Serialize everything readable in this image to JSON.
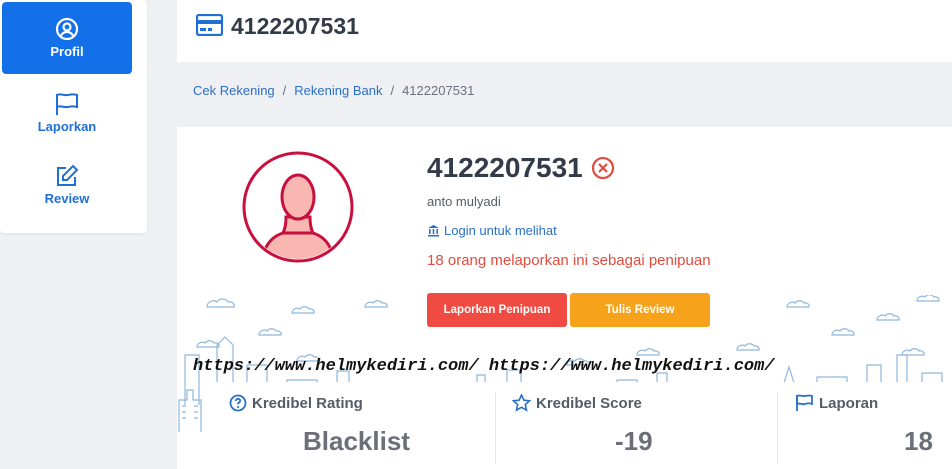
{
  "sidebar": {
    "items": [
      {
        "label": "Profil",
        "icon": "user-circle-icon",
        "active": true
      },
      {
        "label": "Laporkan",
        "icon": "flag-icon",
        "active": false
      },
      {
        "label": "Review",
        "icon": "edit-icon",
        "active": false
      }
    ]
  },
  "header": {
    "title": "4122207531",
    "icon": "credit-card-icon"
  },
  "breadcrumb": [
    "Cek Rekening",
    "Rekening Bank",
    "4122207531"
  ],
  "profile": {
    "account_number": "4122207531",
    "status_icon": "x-circle-icon",
    "owner": "anto mulyadi",
    "login_text": "Login untuk melihat",
    "report_text": "18 orang melaporkan ini sebagai penipuan"
  },
  "buttons": {
    "report": "Laporkan Penipuan",
    "review": "Tulis Review"
  },
  "watermark": "https://www.helmykediri.com/ https://www.helmykediri.com/",
  "stats": [
    {
      "label": "Kredibel Rating",
      "value": "Blacklist",
      "icon": "question-circle-icon"
    },
    {
      "label": "Kredibel Score",
      "value": "-19",
      "icon": "star-icon"
    },
    {
      "label": "Laporan",
      "value": "18",
      "icon": "flag-icon"
    }
  ],
  "colors": {
    "primary": "#1370e8",
    "danger": "#ef4b42",
    "warning": "#f7a21b",
    "avatar_ring": "#c8103e",
    "avatar_fill": "#f8b7b0"
  }
}
